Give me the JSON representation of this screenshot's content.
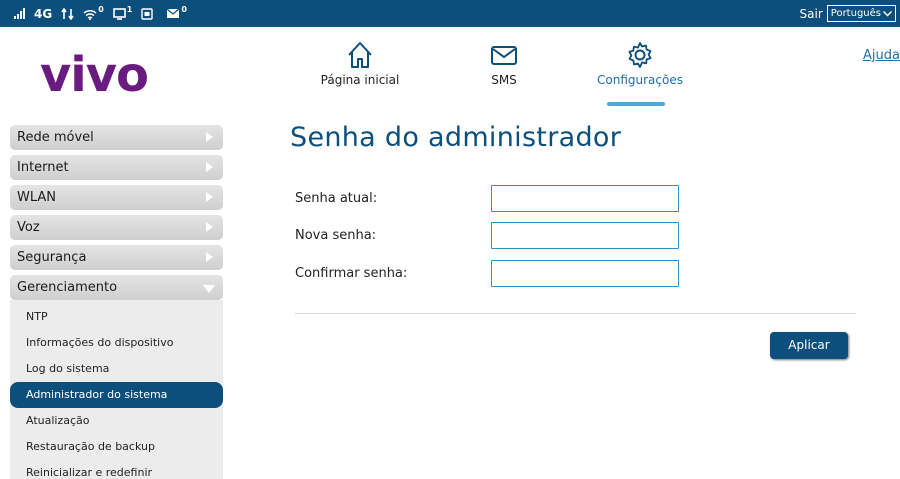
{
  "status_bar": {
    "network": "4G",
    "wifi_count": "0",
    "devices_count": "1",
    "messages_count": "0",
    "logout": "Sair",
    "language": "Português"
  },
  "logo": "vivo",
  "help": "Ajuda",
  "nav": [
    {
      "label": "Página inicial",
      "icon": "home-icon"
    },
    {
      "label": "SMS",
      "icon": "envelope-icon"
    },
    {
      "label": "Configurações",
      "icon": "gear-icon"
    }
  ],
  "sidebar": {
    "items": [
      {
        "label": "Rede móvel"
      },
      {
        "label": "Internet"
      },
      {
        "label": "WLAN"
      },
      {
        "label": "Voz"
      },
      {
        "label": "Segurança"
      },
      {
        "label": "Gerenciamento"
      }
    ],
    "submenu": [
      {
        "label": "NTP"
      },
      {
        "label": "Informações do dispositivo"
      },
      {
        "label": "Log do sistema"
      },
      {
        "label": "Administrador do sistema"
      },
      {
        "label": "Atualização"
      },
      {
        "label": "Restauração de backup"
      },
      {
        "label": "Reinicializar e redefinir"
      }
    ]
  },
  "page": {
    "title": "Senha do administrador",
    "fields": [
      {
        "label": "Senha atual:",
        "value": ""
      },
      {
        "label": "Nova senha:",
        "value": ""
      },
      {
        "label": "Confirmar senha:",
        "value": ""
      }
    ],
    "apply": "Aplicar"
  },
  "colors": {
    "primary": "#0c4f7c",
    "brand": "#6a1b7f",
    "accent": "#4aa9dc"
  }
}
